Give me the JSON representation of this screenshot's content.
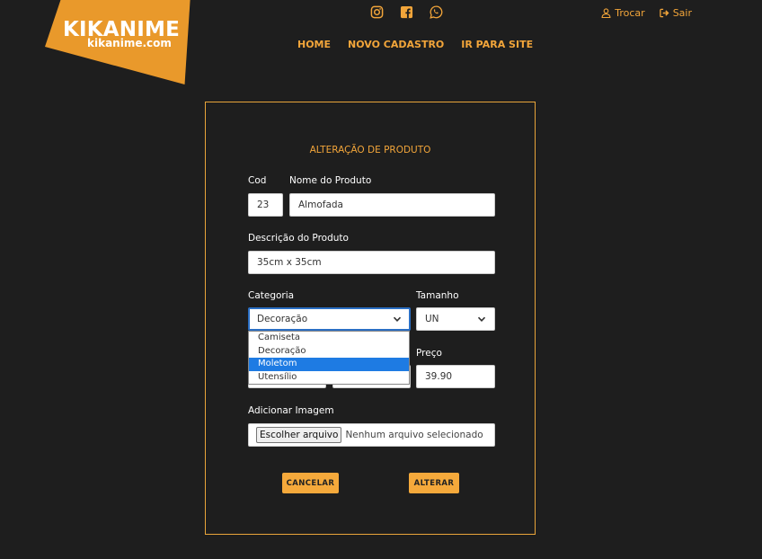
{
  "brand": {
    "name": "KIKANIME",
    "domain": "kikanime.com",
    "color": "#e9992b"
  },
  "social": [
    "instagram-icon",
    "facebook-icon",
    "whatsapp-icon"
  ],
  "toplinks": {
    "switch": "Trocar",
    "logout": "Sair"
  },
  "nav": {
    "home": "HOME",
    "new": "NOVO CADASTRO",
    "site": "IR PARA SITE"
  },
  "form": {
    "title": "ALTERAÇÃO DE PRODUTO",
    "cod_label": "Cod",
    "cod_value": "23",
    "name_label": "Nome do Produto",
    "name_value": "Almofada",
    "desc_label": "Descrição do Produto",
    "desc_value": "35cm x 35cm",
    "category_label": "Categoria",
    "category_value": "Decoração",
    "category_options": [
      "Camiseta",
      "Decoração",
      "Moletom",
      "Utensílio"
    ],
    "size_label": "Tamanho",
    "size_value": "UN",
    "price_label": "Preço",
    "price_value": "39.90",
    "image_label": "Adicionar Imagem",
    "file_button": "Escolher arquivo",
    "file_status": "Nenhum arquivo selecionado",
    "cancel": "CANCELAR",
    "submit": "ALTERAR"
  }
}
